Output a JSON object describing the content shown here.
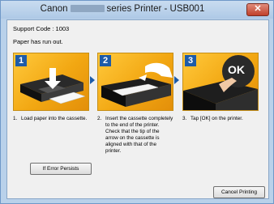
{
  "window": {
    "title_prefix": "Canon",
    "title_suffix": "series Printer - USB001",
    "close_label": "✕"
  },
  "support_code": "Support Code : 1003",
  "message": "Paper has run out.",
  "steps": [
    {
      "number": "1",
      "index": "1.",
      "text": "Load paper into the cassette."
    },
    {
      "number": "2",
      "index": "2.",
      "text": "Insert the cassette completely\nto the end of the printer.\nCheck that the tip of the\narrow on the cassette is\naligned with that of the\nprinter."
    },
    {
      "number": "3",
      "index": "3.",
      "text": "Tap [OK] on the printer.",
      "ok_label": "OK"
    }
  ],
  "buttons": {
    "if_error": "If Error Persists",
    "cancel": "Cancel Printing"
  },
  "colors": {
    "accent": "#1d5ba8",
    "step_background": "#f2a712",
    "window_frame": "#b9d1ea"
  }
}
